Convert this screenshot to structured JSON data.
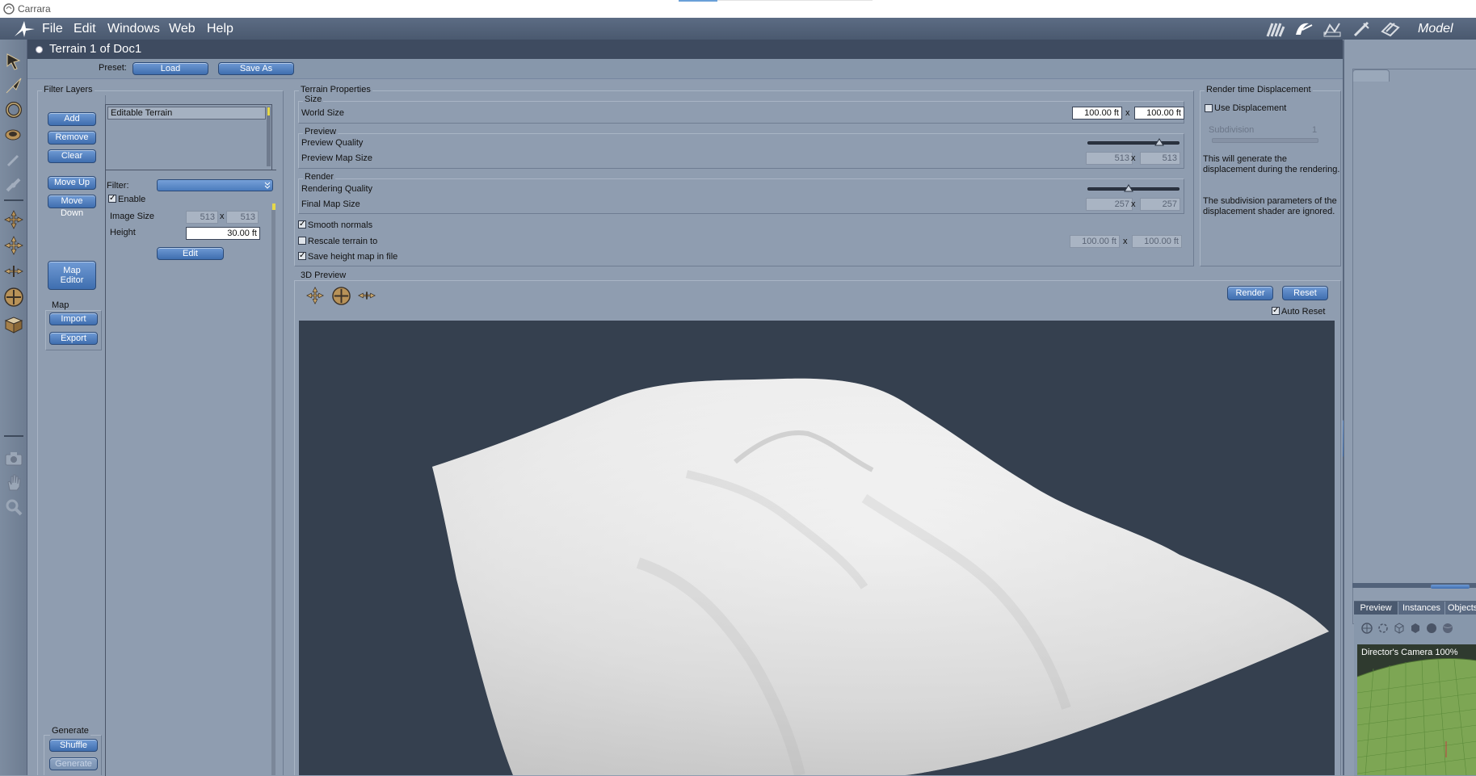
{
  "window": {
    "title": "Carrara"
  },
  "menu": {
    "items": [
      "File",
      "Edit",
      "Windows",
      "Web",
      "Help"
    ],
    "room": "Model"
  },
  "document": {
    "title": "Terrain 1 of Doc1"
  },
  "preset": {
    "label": "Preset:",
    "load": "Load",
    "save_as": "Save As"
  },
  "filter_layers": {
    "title": "Filter Layers",
    "add": "Add",
    "remove": "Remove",
    "clear": "Clear",
    "move_up": "Move Up",
    "move_down": "Move Down",
    "map_editor_1": "Map",
    "map_editor_2": "Editor",
    "layers": [
      "Editable Terrain"
    ],
    "filter_label": "Filter:",
    "enable_label": "Enable",
    "image_size_label": "Image Size",
    "image_w": "513",
    "image_x": "x",
    "image_h": "513",
    "height_label": "Height",
    "height_value": "30.00 ft",
    "edit": "Edit",
    "map_group": "Map",
    "import": "Import",
    "export": "Export",
    "generate_group": "Generate",
    "shuffle": "Shuffle",
    "generate": "Generate"
  },
  "terrain_properties": {
    "title": "Terrain Properties",
    "size_group": "Size",
    "world_size_label": "World Size",
    "world_w": "100.00 ft",
    "world_x": "x",
    "world_h": "100.00 ft",
    "preview_group": "Preview",
    "preview_quality_label": "Preview Quality",
    "preview_map_label": "Preview Map Size",
    "preview_w": "513",
    "preview_x": "x",
    "preview_h": "513",
    "render_group": "Render",
    "rendering_quality_label": "Rendering Quality",
    "final_map_label": "Final Map Size",
    "final_w": "257",
    "final_x": "x",
    "final_h": "257",
    "smooth_normals": "Smooth normals",
    "rescale_label": "Rescale terrain to",
    "rescale_w": "100.00 ft",
    "rescale_x": "x",
    "rescale_h": "100.00 ft",
    "save_height": "Save height map in file"
  },
  "render_time": {
    "title": "Render time Displacement",
    "use_displacement": "Use Displacement",
    "subdivision_label": "Subdivision",
    "subdivision_value": "1",
    "note1": "This will generate the displacement during the rendering.",
    "note2": "The subdivision parameters of the displacement shader are ignored."
  },
  "preview3d": {
    "title": "3D Preview",
    "render": "Render",
    "reset": "Reset",
    "auto_reset": "Auto Reset"
  },
  "right_panel": {
    "tabs": [
      "Preview",
      "Instances",
      "Objects"
    ],
    "camera_label": "Director's Camera 100%"
  },
  "colors": {
    "accent": "#3f6eaf",
    "background": "#8f9db0",
    "preview_bg": "#35404f"
  }
}
